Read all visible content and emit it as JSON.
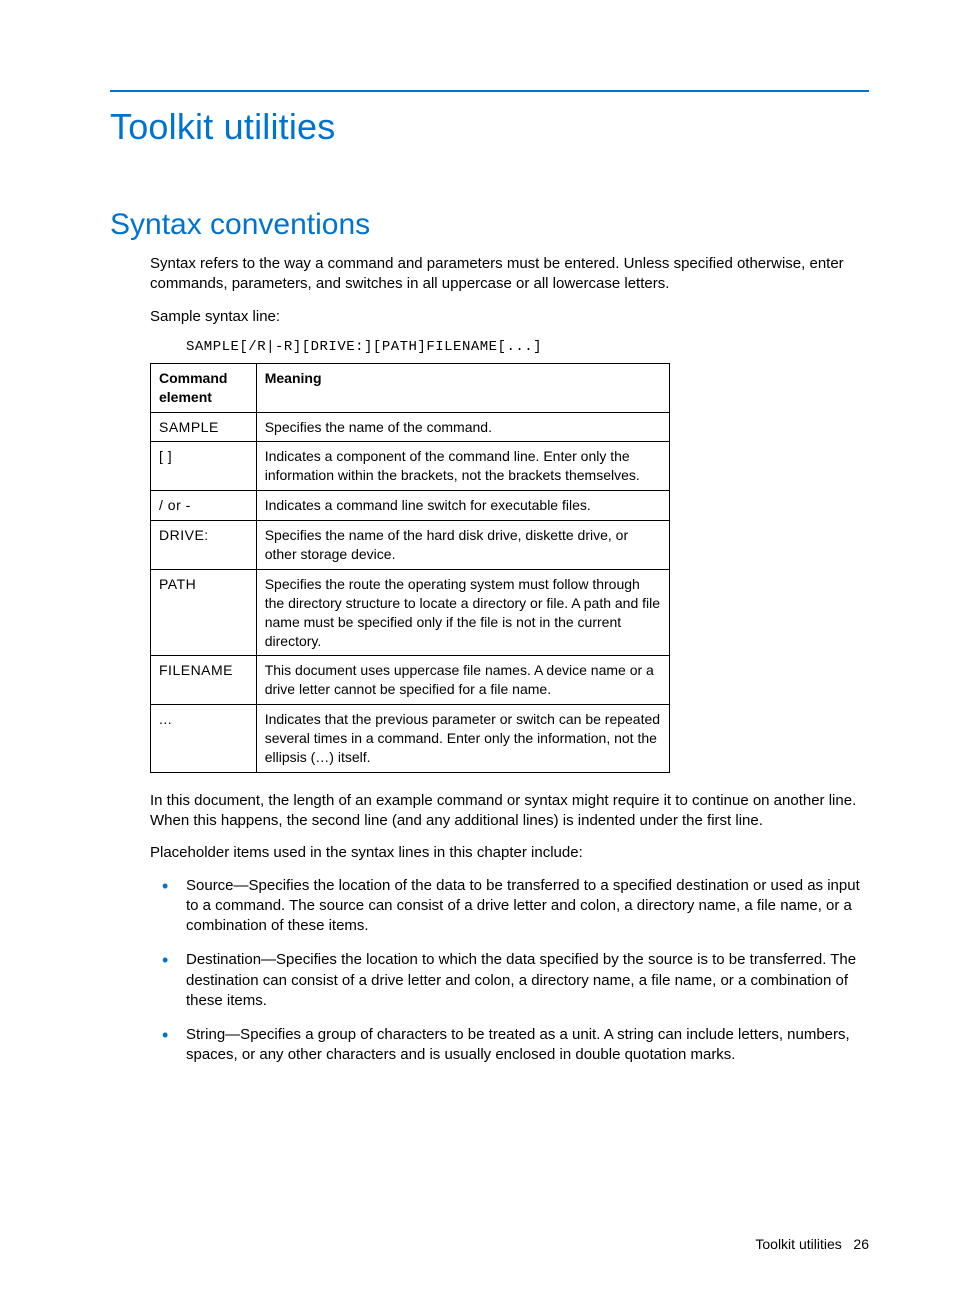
{
  "title": "Toolkit utilities",
  "section": "Syntax conventions",
  "intro": "Syntax refers to the way a command and parameters must be entered. Unless specified otherwise, enter commands, parameters, and switches in all uppercase or all lowercase letters.",
  "sample_label": "Sample syntax line:",
  "sample_code": "SAMPLE[/R|-R][DRIVE:][PATH]FILENAME[...]",
  "table": {
    "headers": [
      "Command element",
      "Meaning"
    ],
    "rows": [
      {
        "el": "SAMPLE",
        "meaning": "Specifies the name of the command."
      },
      {
        "el": "[ ]",
        "meaning": "Indicates a component of the command line. Enter only the information within the brackets, not the brackets themselves."
      },
      {
        "el": "/ or -",
        "meaning": "Indicates a command line switch for executable files."
      },
      {
        "el": "DRIVE:",
        "meaning": "Specifies the name of the hard disk drive, diskette drive, or other storage device."
      },
      {
        "el": "PATH",
        "meaning": "Specifies the route the operating system must follow through the directory structure to locate a directory or file. A path and file name must be specified only if the file is not in the current directory."
      },
      {
        "el": "FILENAME",
        "meaning": "This document uses uppercase file names. A device name or a drive letter cannot be specified for a file name."
      },
      {
        "el": "...",
        "meaning": "Indicates that the previous parameter or switch can be repeated several times in a command. Enter only the information, not the ellipsis (…) itself."
      }
    ]
  },
  "after_table_1": "In this document, the length of an example command or syntax might require it to continue on another line. When this happens, the second line (and any additional lines) is indented under the first line.",
  "after_table_2": "Placeholder items used in the syntax lines in this chapter include:",
  "bullets": [
    "Source—Specifies the location of the data to be transferred to a specified destination or used as input to a command. The source can consist of a drive letter and colon, a directory name, a file name, or a combination of these items.",
    "Destination—Specifies the location to which the data specified by the source is to be transferred. The destination can consist of a drive letter and colon, a directory name, a file name, or a combination of these items.",
    "String—Specifies a group of characters to be treated as a unit. A string can include letters, numbers, spaces, or any other characters and is usually enclosed in double quotation marks."
  ],
  "footer": {
    "label": "Toolkit utilities",
    "page": "26"
  }
}
